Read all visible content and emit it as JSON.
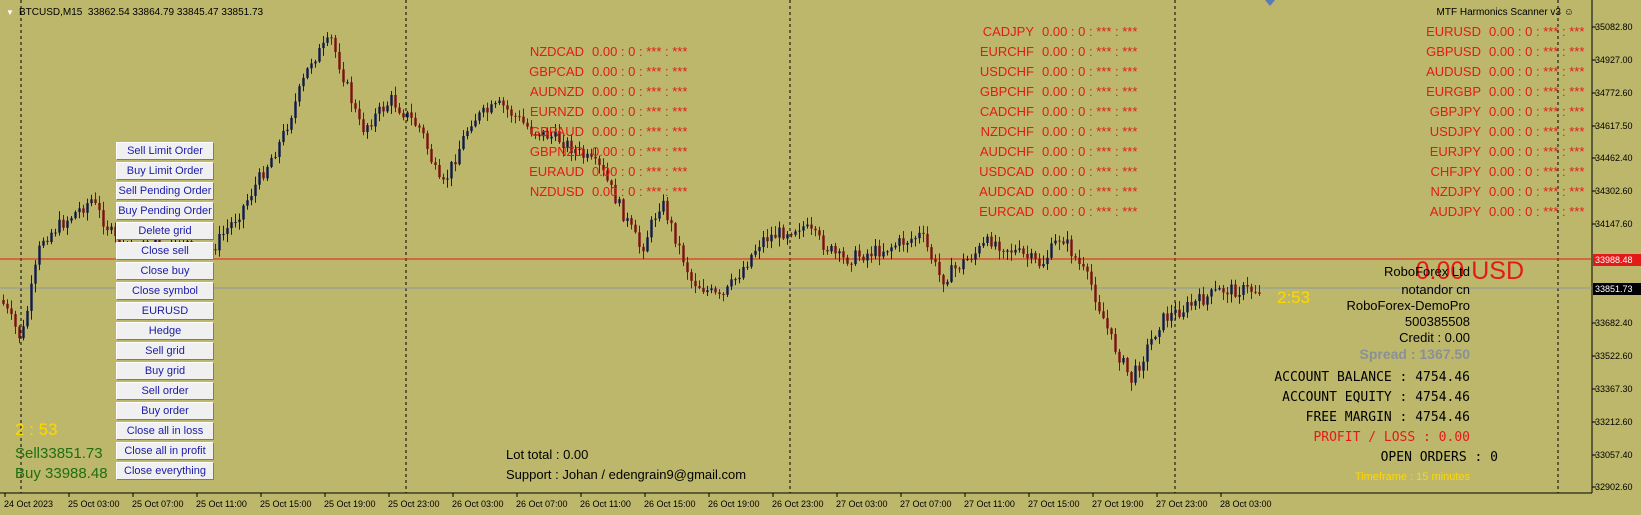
{
  "header": {
    "symbol": "BTCUSD,M15",
    "ohlc": "33862.54 33864.79 33845.47 33851.73"
  },
  "scanner": {
    "title": "MTF Harmonics Scanner v3"
  },
  "pairs": {
    "left": [
      {
        "sym": "NZDCAD",
        "val": "0.00 : 0 : *** : ***"
      },
      {
        "sym": "GBPCAD",
        "val": "0.00 : 0 : *** : ***"
      },
      {
        "sym": "AUDNZD",
        "val": "0.00 : 0 : *** : ***"
      },
      {
        "sym": "EURNZD",
        "val": "0.00 : 0 : *** : ***"
      },
      {
        "sym": "GBPAUD",
        "val": "0.00 : 0 : *** : ***"
      },
      {
        "sym": "GBPNZD",
        "val": "0.00 : 0 : *** : ***"
      },
      {
        "sym": "EURAUD",
        "val": "0.00 : 0 : *** : ***"
      },
      {
        "sym": "NZDUSD",
        "val": "0.00 : 0 : *** : ***"
      }
    ],
    "middle": [
      {
        "sym": "CADJPY",
        "val": "0.00 : 0 : *** : ***"
      },
      {
        "sym": "EURCHF",
        "val": "0.00 : 0 : *** : ***"
      },
      {
        "sym": "USDCHF",
        "val": "0.00 : 0 : *** : ***"
      },
      {
        "sym": "GBPCHF",
        "val": "0.00 : 0 : *** : ***"
      },
      {
        "sym": "CADCHF",
        "val": "0.00 : 0 : *** : ***"
      },
      {
        "sym": "NZDCHF",
        "val": "0.00 : 0 : *** : ***"
      },
      {
        "sym": "AUDCHF",
        "val": "0.00 : 0 : *** : ***"
      },
      {
        "sym": "USDCAD",
        "val": "0.00 : 0 : *** : ***"
      },
      {
        "sym": "AUDCAD",
        "val": "0.00 : 0 : *** : ***"
      },
      {
        "sym": "EURCAD",
        "val": "0.00 : 0 : *** : ***"
      }
    ],
    "right": [
      {
        "sym": "EURUSD",
        "val": "0.00 : 0 : *** : ***"
      },
      {
        "sym": "GBPUSD",
        "val": "0.00 : 0 : *** : ***"
      },
      {
        "sym": "AUDUSD",
        "val": "0.00 : 0 : *** : ***"
      },
      {
        "sym": "EURGBP",
        "val": "0.00 : 0 : *** : ***"
      },
      {
        "sym": "GBPJPY",
        "val": "0.00 : 0 : *** : ***"
      },
      {
        "sym": "USDJPY",
        "val": "0.00 : 0 : *** : ***"
      },
      {
        "sym": "EURJPY",
        "val": "0.00 : 0 : *** : ***"
      },
      {
        "sym": "CHFJPY",
        "val": "0.00 : 0 : *** : ***"
      },
      {
        "sym": "NZDJPY",
        "val": "0.00 : 0 : *** : ***"
      },
      {
        "sym": "AUDJPY",
        "val": "0.00 : 0 : *** : ***"
      }
    ]
  },
  "buttons": [
    "Sell Limit Order",
    "Buy Limit Order",
    "Sell Pending Order",
    "Buy Pending Order",
    "Delete grid",
    "Close sell",
    "Close buy",
    "Close symbol",
    "EURUSD",
    "Hedge",
    "Sell grid",
    "Buy grid",
    "Sell order",
    "Buy order",
    "Close all in loss",
    "Close all in profit",
    "Close everything"
  ],
  "left_info": {
    "timer": "2 : 53",
    "sell": "Sell33851.73",
    "buy": "Buy 33988.48"
  },
  "bottom_info": {
    "lot_total": "Lot total : 0.00",
    "support": "Support : Johan / edengrain9@gmail.com"
  },
  "account": {
    "pnl_big": "0.00 USD",
    "broker": "RoboForex Ltd",
    "name": "notandor cn",
    "server": "RoboForex-DemoPro",
    "number": "500385508",
    "credit": "Credit : 0.00",
    "spread": "Spread : 1367.50",
    "balance": "ACCOUNT BALANCE : 4754.46",
    "equity": "ACCOUNT EQUITY : 4754.46",
    "margin": "FREE MARGIN : 4754.46",
    "profit": "PROFIT / LOSS : 0.00",
    "orders": "OPEN ORDERS : 0",
    "timeframe": "Timeframe : 15 minutes"
  },
  "countdown": "2:53",
  "price_axis": {
    "labels": [
      "35082.80",
      "34927.00",
      "34772.60",
      "34617.50",
      "34462.40",
      "34302.60",
      "34147.60",
      "33682.40",
      "33522.60",
      "33367.30",
      "33212.60",
      "33057.40",
      "32902.60"
    ],
    "ask": "33988.48",
    "bid": "33851.73"
  },
  "time_axis": [
    "24 Oct 2023",
    "25 Oct 03:00",
    "25 Oct 07:00",
    "25 Oct 11:00",
    "25 Oct 15:00",
    "25 Oct 19:00",
    "25 Oct 23:00",
    "26 Oct 03:00",
    "26 Oct 07:00",
    "26 Oct 11:00",
    "26 Oct 15:00",
    "26 Oct 19:00",
    "26 Oct 23:00",
    "27 Oct 03:00",
    "27 Oct 07:00",
    "27 Oct 11:00",
    "27 Oct 15:00",
    "27 Oct 19:00",
    "27 Oct 23:00",
    "28 Oct 03:00"
  ],
  "colors": {
    "background": "#bdb76b",
    "bull": "#0d1a4a",
    "bear": "#7a1010",
    "ask_line": "#e31a1a",
    "bid_line": "#8a9aa0",
    "text_red": "#e31a1a",
    "text_yellow": "#ffd700",
    "text_green": "#1f6e10"
  }
}
